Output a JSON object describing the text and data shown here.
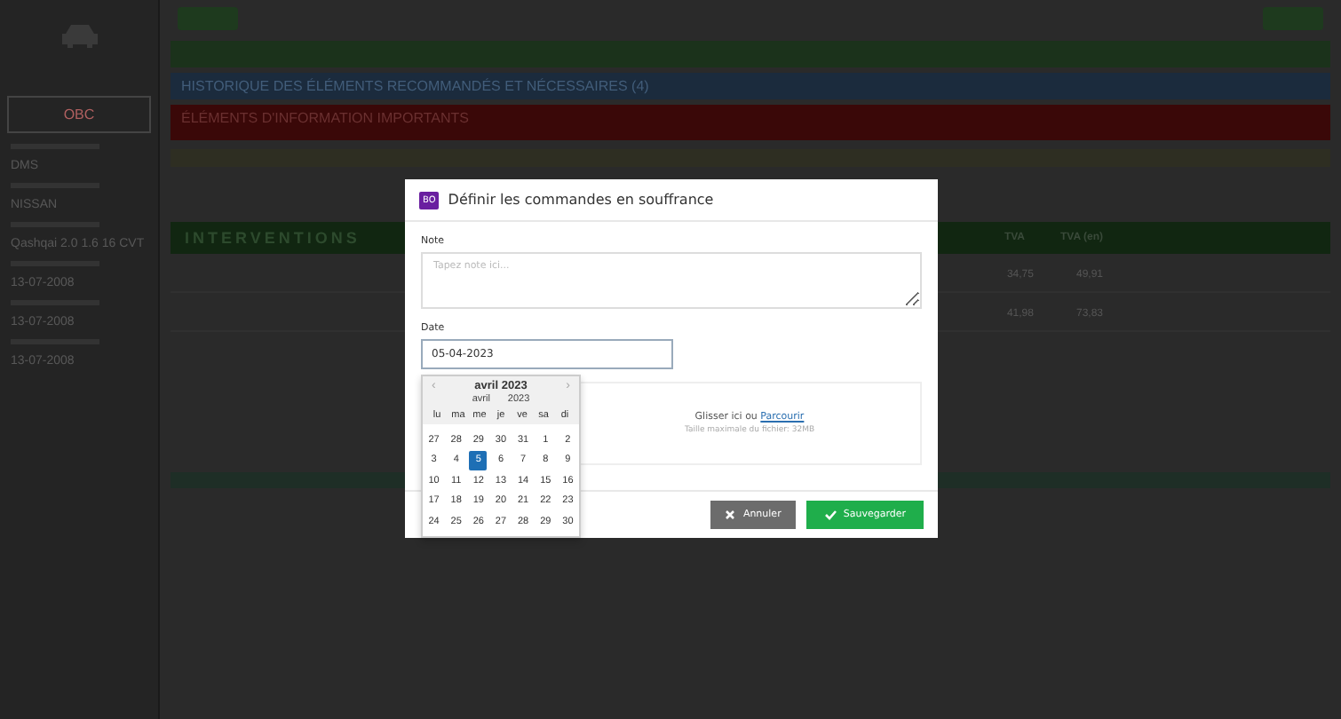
{
  "sidebar": {
    "plate_button": "OBC",
    "fields": [
      {
        "label": "DMS"
      },
      {
        "label": "NISSAN"
      },
      {
        "label": "Qashqai 2.0 1.6 16 CVT"
      },
      {
        "label": "13-07-2008"
      },
      {
        "label": "13-07-2008"
      },
      {
        "label": "13-07-2008"
      }
    ]
  },
  "banners": [
    {
      "kind": "green"
    },
    {
      "kind": "blue",
      "text": "HISTORIQUE DES ÉLÉMENTS RECOMMANDÉS ET NÉCESSAIRES (4)"
    },
    {
      "kind": "red",
      "text": "ÉLÉMENTS D'INFORMATION IMPORTANTS"
    }
  ],
  "interventions": {
    "title": "INTERVENTIONS",
    "columns": [
      "TVA",
      "TVA (en)"
    ],
    "rows": [
      [
        "34,75",
        "49,91"
      ],
      [
        "41,98",
        "73,83"
      ]
    ]
  },
  "modal": {
    "badge": "BO",
    "title": "Définir les commandes en souffrance",
    "note_label": "Note",
    "note_placeholder": "Tapez note ici...",
    "date_label": "Date",
    "date_value": "05-04-2023",
    "upload_text": "Glisser ici ou ",
    "upload_link": "Parcourir",
    "upload_hint": "Taille maximale du fichier: 32MB",
    "cancel": "Annuler",
    "save": "Sauvegarder"
  },
  "calendar": {
    "prev": "‹",
    "next": "›",
    "title": "avril 2023",
    "month_select": "avril",
    "year_select": "2023",
    "weekdays": [
      "lu",
      "ma",
      "me",
      "je",
      "ve",
      "sa",
      "di"
    ],
    "weeks": [
      [
        {
          "d": "27",
          "selected": false
        },
        {
          "d": "28",
          "selected": false
        },
        {
          "d": "29",
          "selected": false
        },
        {
          "d": "30",
          "selected": false
        },
        {
          "d": "31",
          "selected": false
        },
        {
          "d": "1",
          "selected": false
        },
        {
          "d": "2",
          "selected": false
        }
      ],
      [
        {
          "d": "3",
          "selected": false
        },
        {
          "d": "4",
          "selected": false
        },
        {
          "d": "5",
          "selected": true
        },
        {
          "d": "6",
          "selected": false
        },
        {
          "d": "7",
          "selected": false
        },
        {
          "d": "8",
          "selected": false
        },
        {
          "d": "9",
          "selected": false
        }
      ],
      [
        {
          "d": "10",
          "selected": false
        },
        {
          "d": "11",
          "selected": false
        },
        {
          "d": "12",
          "selected": false
        },
        {
          "d": "13",
          "selected": false
        },
        {
          "d": "14",
          "selected": false
        },
        {
          "d": "15",
          "selected": false
        },
        {
          "d": "16",
          "selected": false
        }
      ],
      [
        {
          "d": "17",
          "selected": false
        },
        {
          "d": "18",
          "selected": false
        },
        {
          "d": "19",
          "selected": false
        },
        {
          "d": "20",
          "selected": false
        },
        {
          "d": "21",
          "selected": false
        },
        {
          "d": "22",
          "selected": false
        },
        {
          "d": "23",
          "selected": false
        }
      ],
      [
        {
          "d": "24",
          "selected": false
        },
        {
          "d": "25",
          "selected": false
        },
        {
          "d": "26",
          "selected": false
        },
        {
          "d": "27",
          "selected": false
        },
        {
          "d": "28",
          "selected": false
        },
        {
          "d": "29",
          "selected": false
        },
        {
          "d": "30",
          "selected": false
        }
      ]
    ]
  }
}
